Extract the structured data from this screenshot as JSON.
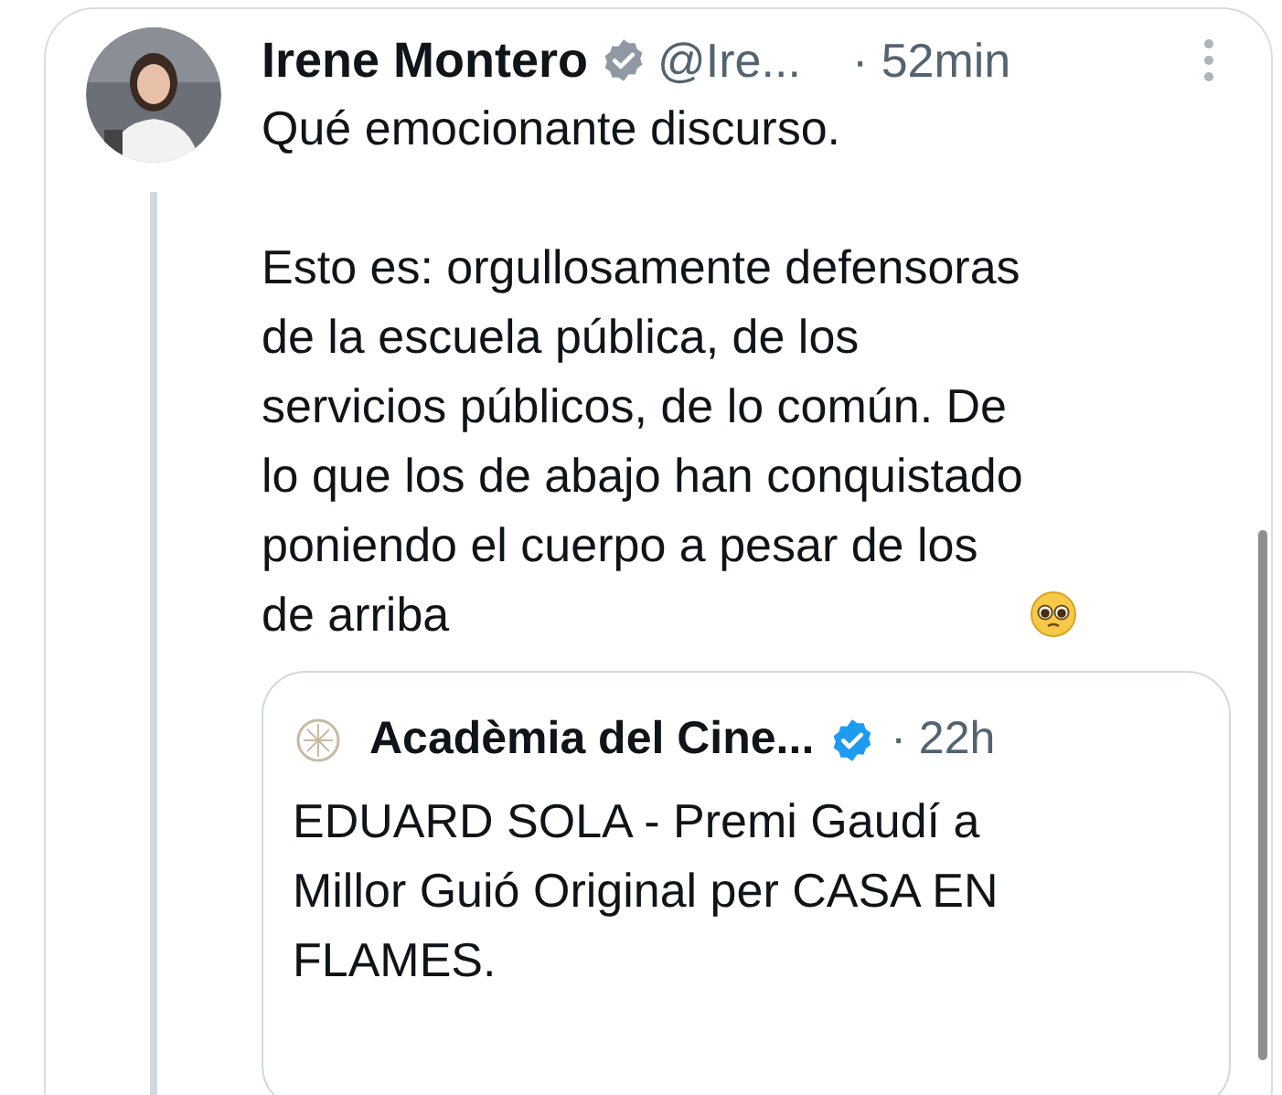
{
  "tweet": {
    "author": "Irene Montero",
    "verified": true,
    "handle": "@Ire...",
    "time": "· 52min",
    "paragraphs": [
      "Qué emocionante discurso.",
      "Esto es: orgullosamente defensoras\nde la escuela pública, de los\nservicios públicos, de lo común. De\nlo que los de abajo han conquistado\nponiendo el cuerpo a pesar de los\nde arriba"
    ],
    "quote": {
      "author": "Acadèmia del Cine...",
      "verified": true,
      "time": "· 22h",
      "text": "EDUARD SOLA - Premi Gaudí a\nMillor Guió Original per CASA EN\nFLAMES."
    }
  }
}
